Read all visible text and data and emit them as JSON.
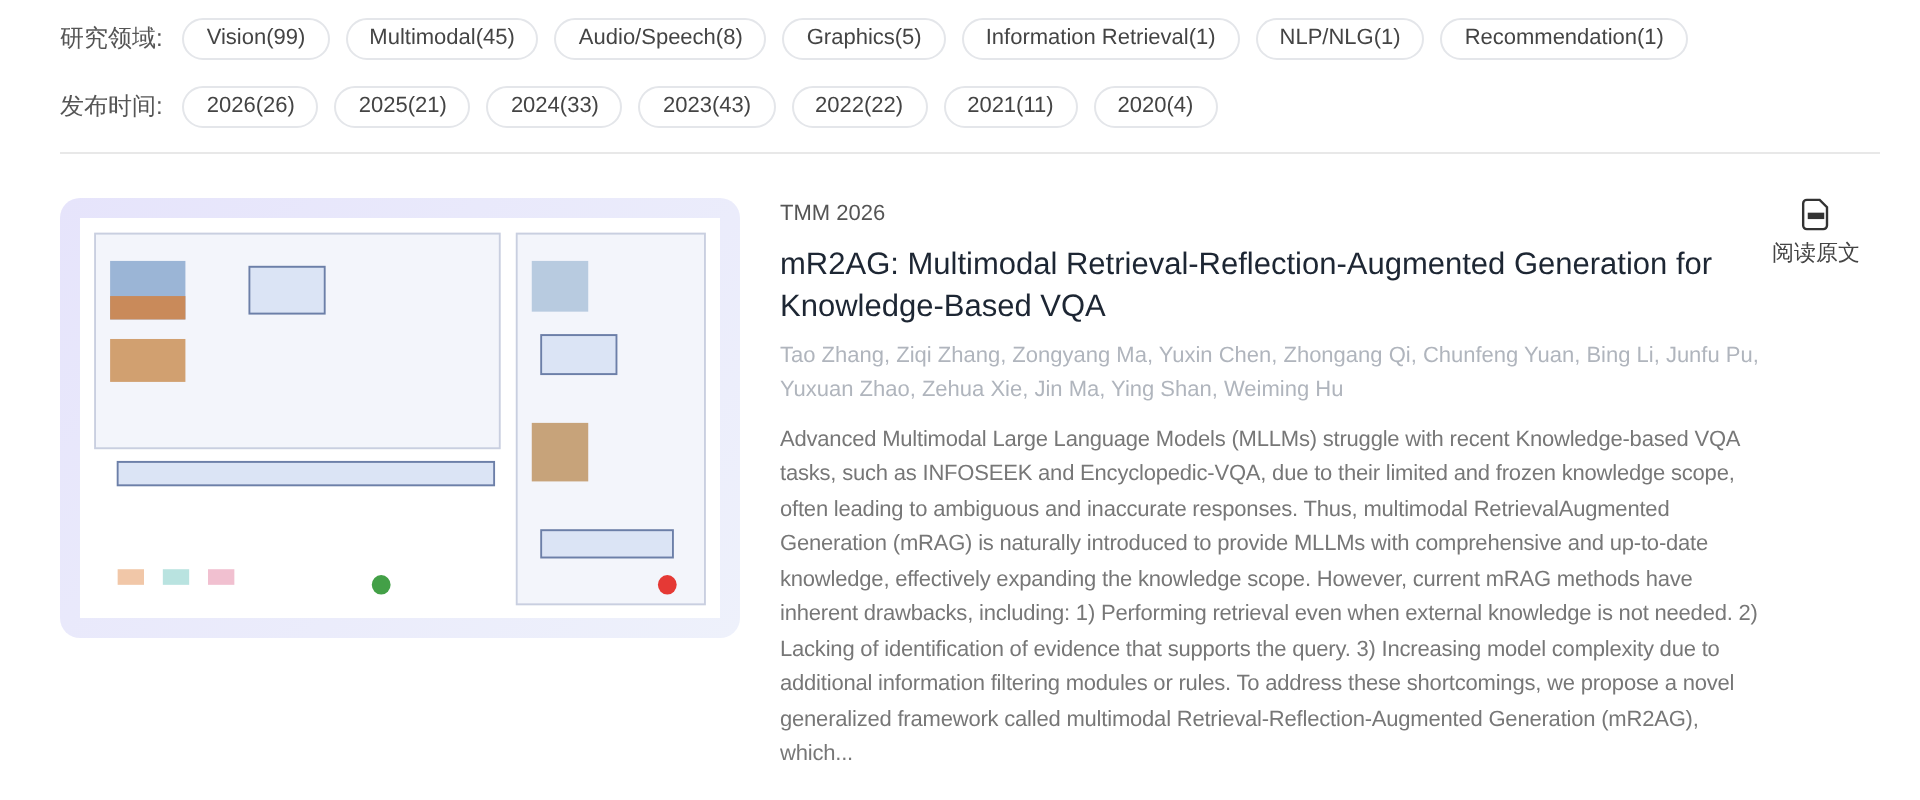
{
  "filters": [
    {
      "label": "研究领域:",
      "chips": [
        {
          "label": "Vision(99)",
          "selected": false
        },
        {
          "label": "Multimodal(45)",
          "selected": false
        },
        {
          "label": "Audio/Speech(8)",
          "selected": false
        },
        {
          "label": "Graphics(5)",
          "selected": false
        },
        {
          "label": "Information Retrieval(1)",
          "selected": false
        },
        {
          "label": "NLP/NLG(1)",
          "selected": false
        },
        {
          "label": "Recommendation(1)",
          "selected": false
        }
      ]
    },
    {
      "label": "发布时间:",
      "chips": [
        {
          "label": "2026(26)",
          "selected": false
        },
        {
          "label": "2025(21)",
          "selected": false
        },
        {
          "label": "2024(33)",
          "selected": false
        },
        {
          "label": "2023(43)",
          "selected": false
        },
        {
          "label": "2022(22)",
          "selected": false
        },
        {
          "label": "2021(11)",
          "selected": false
        },
        {
          "label": "2020(4)",
          "selected": false
        }
      ]
    }
  ],
  "paper": {
    "venue": "TMM 2026",
    "title": "mR2AG: Multimodal Retrieval-Reflection-Augmented Generation for Knowledge-Based VQA",
    "authors": "Tao Zhang, Ziqi Zhang, Zongyang Ma, Yuxin Chen, Zhongang Qi, Chunfeng Yuan, Bing Li, Junfu Pu, Yuxuan Zhao, Zehua Xie, Jin Ma, Ying Shan, Weiming Hu",
    "abstract": "Advanced Multimodal Large Language Models (MLLMs) struggle with recent Knowledge-based VQA tasks, such as INFOSEEK and Encyclopedic-VQA, due to their limited and frozen knowledge scope, often leading to ambiguous and inaccurate responses. Thus, multimodal RetrievalAugmented Generation (mRAG) is naturally introduced to provide MLLMs with comprehensive and up-to-date knowledge, effectively expanding the knowledge scope. However, current mRAG methods have inherent drawbacks, including: 1) Performing retrieval even when external knowledge is not needed. 2) Lacking of identification of evidence that supports the query. 3) Increasing model complexity due to additional information filtering modules or rules. To address these shortcomings, we propose a novel generalized framework called multimodal Retrieval-Reflection-Augmented Generation (mR2AG), which...",
    "pdf_link": {
      "label": "阅读原文"
    }
  }
}
